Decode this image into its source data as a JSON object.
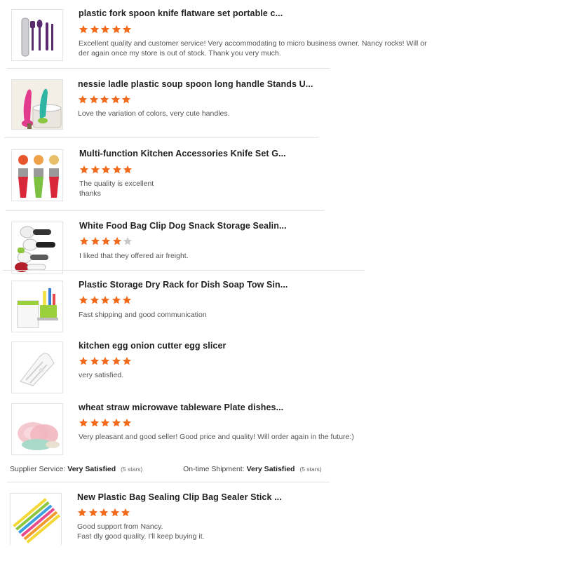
{
  "colors": {
    "star": "#f26b1d",
    "star_empty": "#c8c8c8"
  },
  "reviews": [
    {
      "title": "plastic fork spoon knife flatware set portable c...",
      "rating": 5,
      "text": [
        "Excellent quality and customer service! Very accommodating to micro business owner. Nancy rocks! Will or",
        "der again once my store is out of stock. Thank you very much."
      ],
      "thumb": "purple-cutlery-set-image"
    },
    {
      "title": "nessie ladle plastic soup spoon long handle Stands U...",
      "rating": 5,
      "text": [
        "Love the variation of colors, very cute handles."
      ],
      "thumb": "nessie-ladle-image"
    },
    {
      "title": "Multi-function Kitchen Accessories Knife Set G...",
      "rating": 5,
      "text": [
        "The quality is excellent",
        "thanks"
      ],
      "thumb": "peeler-set-image"
    },
    {
      "title": "White Food Bag Clip Dog Snack Storage Sealin...",
      "rating": 4,
      "text": [
        "I liked that they offered air freight."
      ],
      "thumb": "bag-clip-scoops-image"
    },
    {
      "title": "Plastic Storage Dry Rack for Dish Soap Tow Sin...",
      "rating": 5,
      "text": [
        "Fast shipping and good communication"
      ],
      "thumb": "sink-rack-image"
    },
    {
      "title": "kitchen egg onion cutter egg slicer",
      "rating": 5,
      "text": [
        "very satisfied."
      ],
      "thumb": "egg-slicer-image"
    },
    {
      "title": "wheat straw microwave tableware Plate dishes...",
      "rating": 5,
      "text": [
        "Very pleasant and good seller! Good price and  quality! Will order again in the future:)"
      ],
      "thumb": "wheat-plates-image"
    },
    {
      "title": "New Plastic Bag Sealing Clip Bag Sealer Stick ...",
      "rating": 5,
      "text": [
        "Good support from Nancy.",
        "Fast dly good quality. I'll keep buying it."
      ],
      "thumb": "bag-sealer-sticks-image"
    }
  ],
  "supplier_summary": {
    "supplier_label": "Supplier Service:",
    "supplier_value": "Very Satisfied",
    "supplier_stars": "(5 stars)",
    "shipment_label": "On-time Shipment:",
    "shipment_value": "Very Satisfied",
    "shipment_stars": "(5 stars)"
  }
}
